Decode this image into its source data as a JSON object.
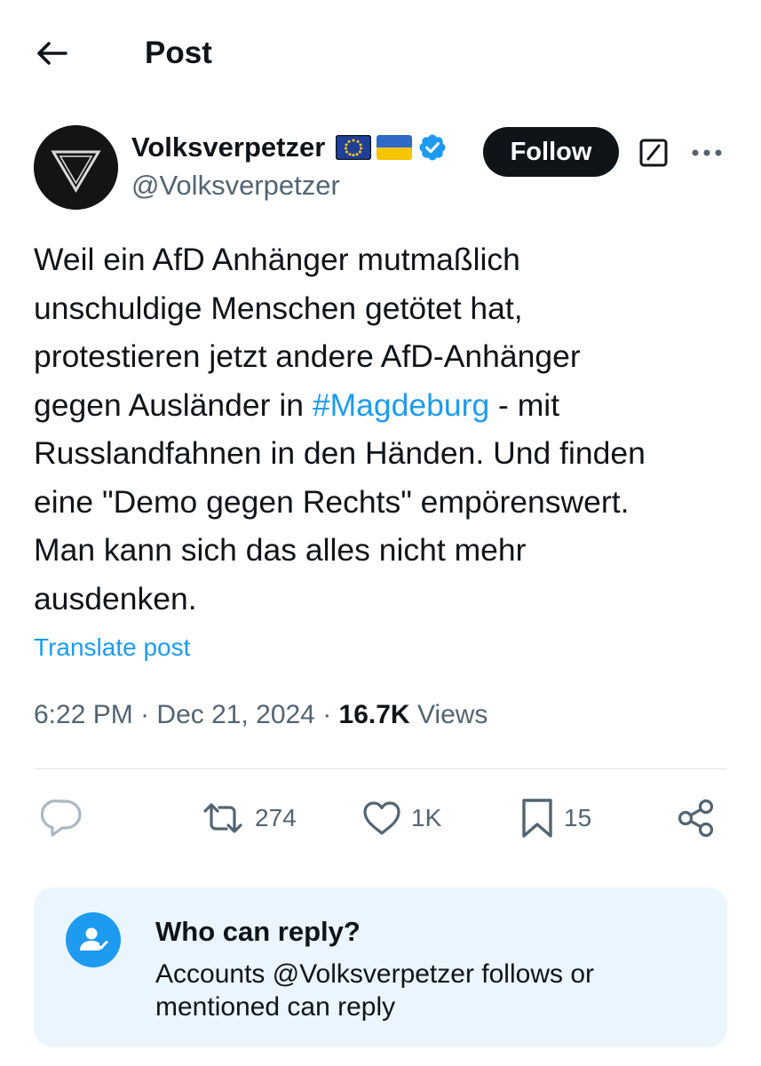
{
  "header": {
    "back_icon": "arrow-left-icon",
    "title": "Post"
  },
  "author": {
    "display_name": "Volksverpetzer",
    "handle": "@Volksverpetzer",
    "badges": [
      "eu-flag-icon",
      "ukraine-flag-icon",
      "verified-badge-icon"
    ],
    "follow_label": "Follow"
  },
  "post": {
    "text_before_hashtag": "Weil ein AfD Anhänger mutmaßlich\nunschuldige Menschen getötet hat,\nprotestieren jetzt andere AfD-Anhänger\ngegen Ausländer in ",
    "hashtag": "#Magdeburg",
    "text_after_hashtag": " - mit\nRusslandfahnen in den Händen. Und finden\neine \"Demo gegen Rechts\" empörenswert.\nMan kann sich das alles nicht mehr\nausdenken.",
    "translate_label": "Translate post"
  },
  "meta": {
    "time": "6:22 PM",
    "separator": " · ",
    "date": "Dec 21, 2024",
    "views_count": "16.7K",
    "views_label": "Views"
  },
  "actions": {
    "reply_count": "",
    "repost_count": "274",
    "like_count": "1K",
    "bookmark_count": "15"
  },
  "reply_restriction": {
    "title": "Who can reply?",
    "description": "Accounts @Volksverpetzer follows or mentioned can reply"
  },
  "colors": {
    "accent": "#1d9bf0",
    "text_primary": "#0f1419",
    "text_secondary": "#536471",
    "card_background": "#eaf5fd"
  }
}
